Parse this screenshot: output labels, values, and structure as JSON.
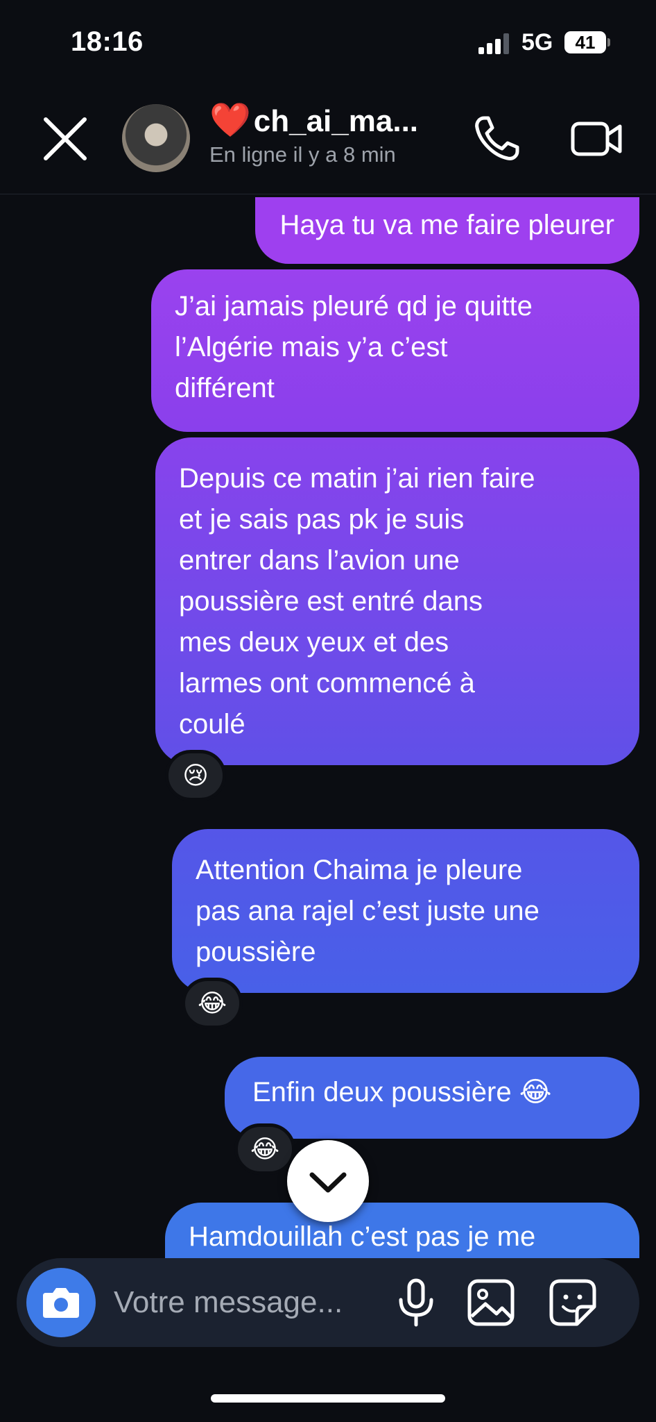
{
  "status_bar": {
    "time": "18:16",
    "network": "5G",
    "battery": "41"
  },
  "header": {
    "heart": "❤️",
    "contact_name": "ch_ai_ma...",
    "presence": "En ligne il y a 8 min"
  },
  "messages": [
    {
      "text": "Haya tu va me faire pleurer"
    },
    {
      "text": "J’ai jamais pleuré qd je quitte\nl’Algérie mais y’a c’est\ndifférent"
    },
    {
      "text": "Depuis ce matin j’ai rien faire\net je sais pas pk je suis\nentrer dans l’avion une\npoussière est entré dans\nmes deux yeux et des\nlarmes ont commencé à\ncoulé",
      "reaction": "😢"
    },
    {
      "text": "Attention Chaima je pleure\npas ana rajel c’est juste une\npoussière",
      "reaction": "😂"
    },
    {
      "text": "Enfin deux poussière 😂",
      "reaction": "😂"
    },
    {
      "text": "Hamdouillah c’est pas je me"
    }
  ],
  "composer": {
    "placeholder": "Votre message..."
  },
  "colors": {
    "background": "#0b0d12",
    "bubble_top": "#a23ff0",
    "bubble_bottom": "#3d82e8",
    "camera_button": "#3e7be8",
    "heart": "#ff2a2a"
  },
  "icons": [
    "close-icon",
    "phone-icon",
    "video-camera-icon",
    "chevron-down-icon",
    "camera-icon",
    "microphone-icon",
    "image-icon",
    "sticker-icon"
  ]
}
